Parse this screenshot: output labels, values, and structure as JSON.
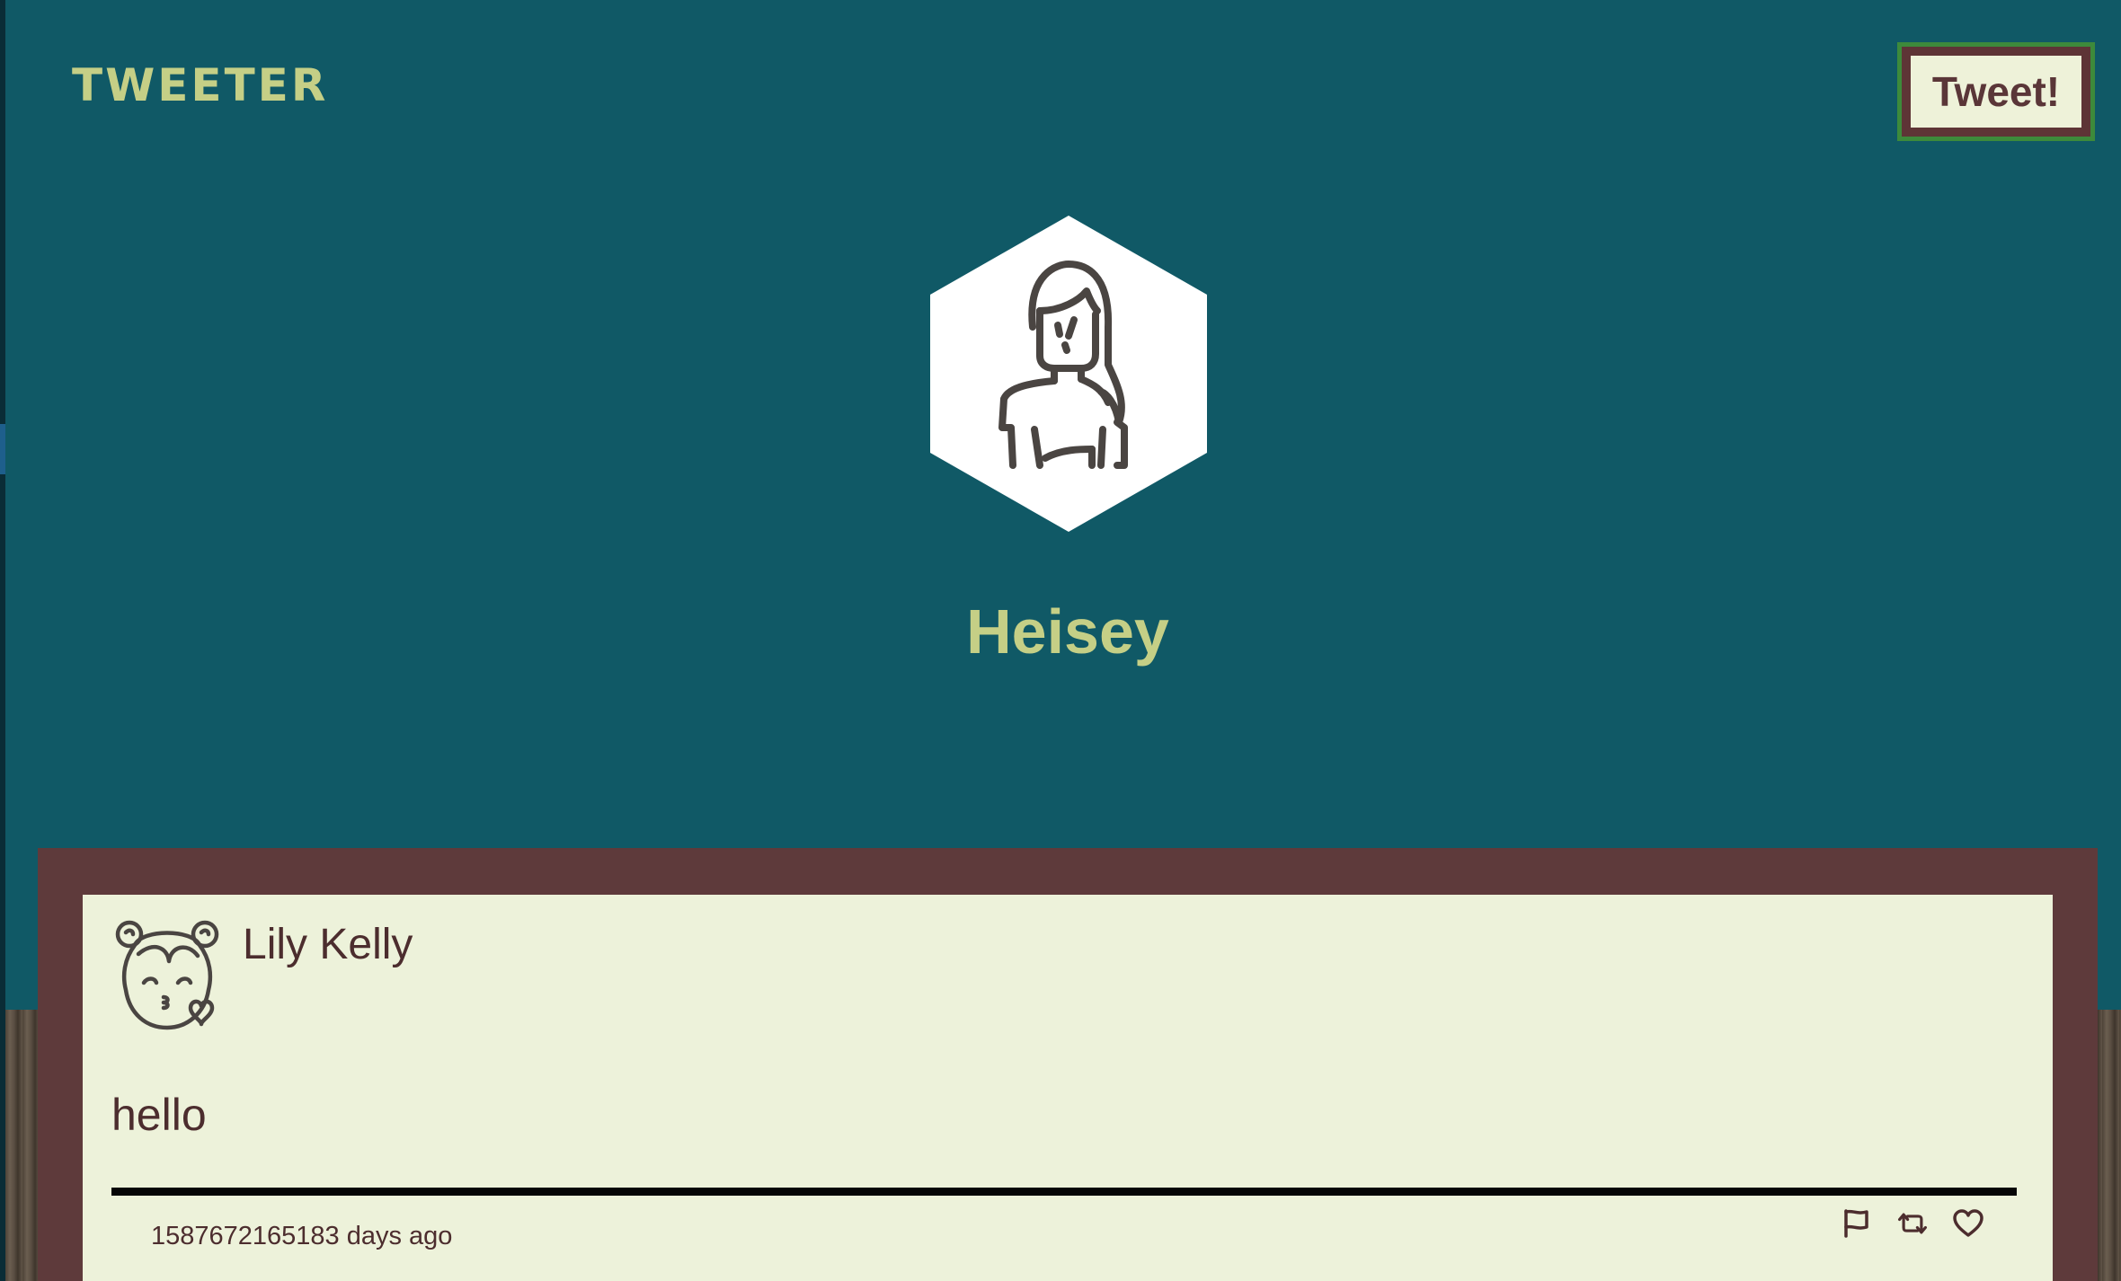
{
  "nav": {
    "brand": "TWEETER",
    "tweet_button_label": "Tweet!"
  },
  "profile": {
    "name": "Heisey",
    "avatar_icon": "woman-avatar-icon"
  },
  "tweets": [
    {
      "author": "Lily Kelly",
      "avatar_icon": "girl-kiss-avatar-icon",
      "text": "hello",
      "time": "1587672165183 days ago",
      "actions": [
        "flag-icon",
        "retweet-icon",
        "heart-icon"
      ]
    }
  ],
  "colors": {
    "background": "#105966",
    "accent": "#c5cf86",
    "panel": "#5e3a3b",
    "card": "#edf2da",
    "text": "#4c2d2e"
  }
}
